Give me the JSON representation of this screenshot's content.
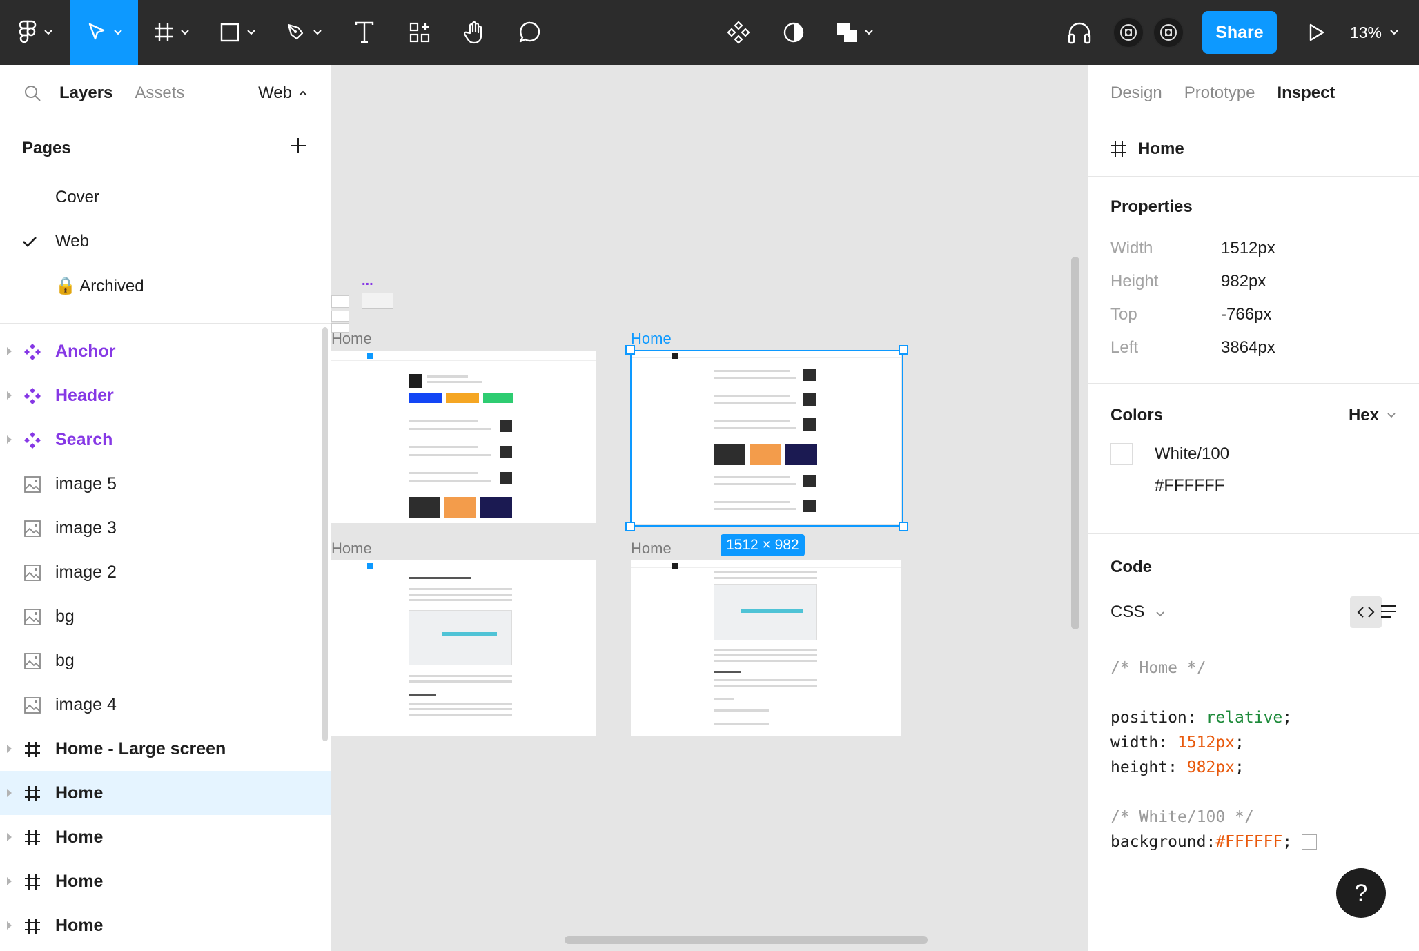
{
  "toolbar": {
    "zoom": "13%",
    "share_label": "Share"
  },
  "left_panel": {
    "tabs": [
      "Layers",
      "Assets"
    ],
    "current_page": "Web",
    "pages_title": "Pages",
    "pages": [
      {
        "label": "Cover",
        "checked": false
      },
      {
        "label": "Web",
        "checked": true
      },
      {
        "label": "🔒 Archived",
        "checked": false
      }
    ],
    "layers": [
      {
        "label": "Anchor",
        "type": "component"
      },
      {
        "label": "Header",
        "type": "component"
      },
      {
        "label": "Search",
        "type": "component"
      },
      {
        "label": "image 5",
        "type": "image"
      },
      {
        "label": "image 3",
        "type": "image"
      },
      {
        "label": "image 2",
        "type": "image"
      },
      {
        "label": "bg",
        "type": "image"
      },
      {
        "label": "bg",
        "type": "image"
      },
      {
        "label": "image 4",
        "type": "image"
      },
      {
        "label": "Home - Large screen",
        "type": "frame"
      },
      {
        "label": "Home",
        "type": "frame",
        "selected": true
      },
      {
        "label": "Home",
        "type": "frame"
      },
      {
        "label": "Home",
        "type": "frame"
      },
      {
        "label": "Home",
        "type": "frame"
      }
    ]
  },
  "canvas": {
    "frame_labels": [
      "Home",
      "Home",
      "Home",
      "Home"
    ],
    "size_badge": "1512 × 982",
    "dots": "..."
  },
  "right_panel": {
    "tabs": [
      "Design",
      "Prototype",
      "Inspect"
    ],
    "selected_name": "Home",
    "properties_title": "Properties",
    "properties": [
      {
        "key": "Width",
        "value": "1512px"
      },
      {
        "key": "Height",
        "value": "982px"
      },
      {
        "key": "Top",
        "value": "-766px"
      },
      {
        "key": "Left",
        "value": "3864px"
      }
    ],
    "colors_title": "Colors",
    "color_format": "Hex",
    "color_name": "White/100",
    "color_hex": "#FFFFFF",
    "code_title": "Code",
    "code_lang": "CSS",
    "code": {
      "comment1": "/* Home */",
      "pos_key": "position: ",
      "pos_val": "relative",
      "w_key": "width: ",
      "w_val": "1512px",
      "h_key": "height: ",
      "h_val": "982px",
      "comment2": "/* White/100 */",
      "bg_key": "background: ",
      "bg_val": "#FFFFFF"
    },
    "help": "?"
  },
  "colors": {
    "accent": "#0d99ff",
    "component": "#8638e5",
    "toolbar_bg": "#2c2c2c"
  }
}
